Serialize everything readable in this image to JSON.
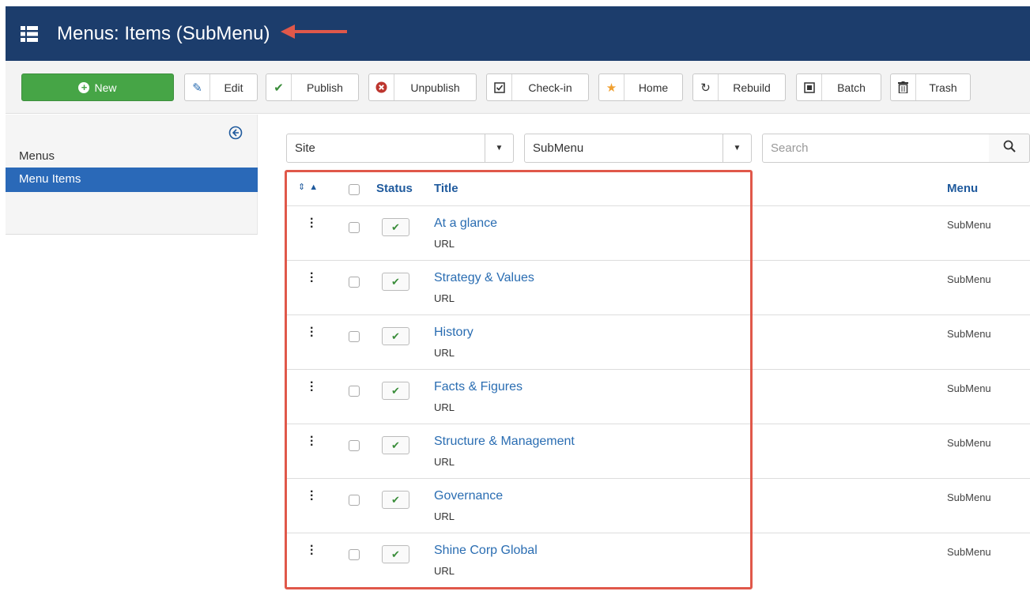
{
  "header": {
    "title": "Menus: Items (SubMenu)",
    "icon": "list-icon"
  },
  "toolbar": {
    "new": "New",
    "edit": "Edit",
    "publish": "Publish",
    "unpublish": "Unpublish",
    "checkin": "Check-in",
    "home": "Home",
    "rebuild": "Rebuild",
    "batch": "Batch",
    "trash": "Trash"
  },
  "sidebar": {
    "items": [
      "Menus",
      "Menu Items"
    ]
  },
  "filters": {
    "site": "Site",
    "menu": "SubMenu",
    "search_placeholder": "Search"
  },
  "table": {
    "headers": {
      "status": "Status",
      "title": "Title",
      "menu": "Menu"
    },
    "rows": [
      {
        "title": "At a glance",
        "type": "URL",
        "menu": "SubMenu"
      },
      {
        "title": "Strategy & Values",
        "type": "URL",
        "menu": "SubMenu"
      },
      {
        "title": "History",
        "type": "URL",
        "menu": "SubMenu"
      },
      {
        "title": "Facts & Figures",
        "type": "URL",
        "menu": "SubMenu"
      },
      {
        "title": "Structure & Management",
        "type": "URL",
        "menu": "SubMenu"
      },
      {
        "title": "Governance",
        "type": "URL",
        "menu": "SubMenu"
      },
      {
        "title": "Shine Corp Global",
        "type": "URL",
        "menu": "SubMenu"
      }
    ]
  },
  "colors": {
    "header_bg": "#1c3d6c",
    "new_button": "#46a546",
    "active_sidebar": "#2a69b8",
    "link": "#2a6db2",
    "highlight": "#e0584a"
  }
}
